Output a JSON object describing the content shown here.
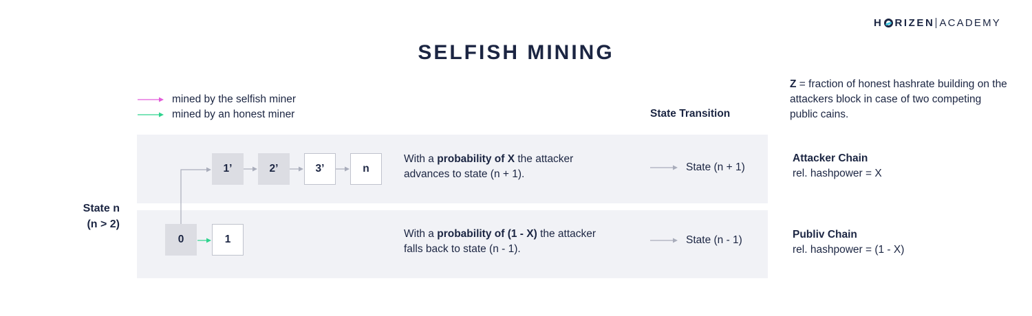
{
  "logo": {
    "brand_left": "H",
    "brand_right": "RIZEN",
    "academy": "ACADEMY"
  },
  "title": "SELFISH MINING",
  "legend": {
    "selfish": "mined by the selfish miner",
    "honest": "mined by an honest miner"
  },
  "colors": {
    "selfish": "#e25bd9",
    "honest": "#2fd38e",
    "arrow": "#a9adbb",
    "band": "#f1f2f6"
  },
  "note": {
    "var": "Z",
    "text": " = fraction of honest hashrate building on the attackers block in case of two competing public cains."
  },
  "state_transition_header": "State Transition",
  "state": {
    "line1": "State n",
    "line2": "(n > 2)"
  },
  "attacker_blocks": [
    "1’",
    "2’",
    "3’",
    "n"
  ],
  "honest_blocks": [
    "0",
    "1"
  ],
  "rows": [
    {
      "desc_pre": "With a ",
      "desc_bold": "probability of X",
      "desc_post": " the attacker advances to state (n + 1).",
      "transition": "State (n + 1)",
      "chain_name": "Attacker Chain",
      "chain_hash": "rel. hashpower = X"
    },
    {
      "desc_pre": "With a ",
      "desc_bold": "probability of (1 - X)",
      "desc_post": " the attacker falls back to state (n - 1).",
      "transition": "State (n - 1)",
      "chain_name": "Publiv Chain",
      "chain_hash": "rel. hashpower = (1 - X)"
    }
  ]
}
